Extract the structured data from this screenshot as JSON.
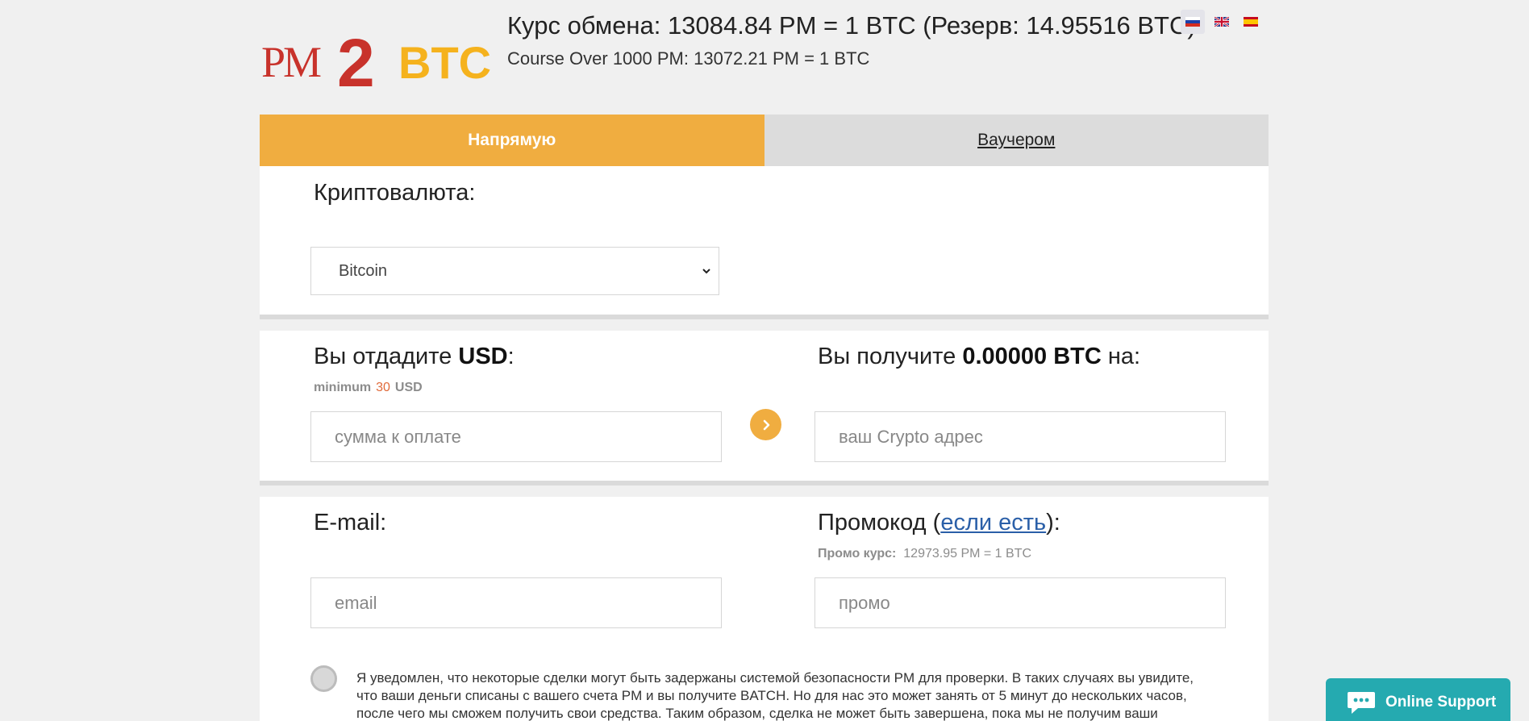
{
  "header": {
    "logo_text_pm": "PM",
    "logo_text_2": "2",
    "logo_text_btc": "BTC",
    "rate_main": "Курс обмена: 13084.84 PM = 1 BTC (Резерв: 14.95516 BTC)",
    "rate_sub": "Course Over 1000 PM: 13072.21 PM = 1 BTC",
    "languages": [
      "ru-flag-icon",
      "uk-flag-icon",
      "es-flag-icon"
    ]
  },
  "tabs": {
    "direct": "Напрямую",
    "voucher": "Ваучером"
  },
  "crypto": {
    "label": "Криптовалюта:",
    "selected": "Bitcoin"
  },
  "give": {
    "label_prefix": "Вы отдадите ",
    "currency": "USD",
    "label_suffix": ":",
    "min_label": "minimum",
    "min_value": "30",
    "min_currency": "USD",
    "placeholder": "сумма к оплате"
  },
  "receive": {
    "label_prefix": "Вы получите ",
    "amount": "0.00000 BTC",
    "label_suffix": " на:",
    "placeholder": "ваш Crypto адрес"
  },
  "email": {
    "label": "E-mail:",
    "placeholder": "email"
  },
  "promo": {
    "label_prefix": "Промокод (",
    "link": "если есть",
    "label_suffix": "):",
    "rate_label": "Промо курс:",
    "rate_value": "12973.95 PM = 1 BTC",
    "placeholder": "промо"
  },
  "notice": {
    "text": "Я уведомлен, что некоторые сделки могут быть задержаны системой безопасности PM для проверки. В таких случаях вы увидите, что ваши деньги списаны с вашего счета PM и вы получите BATCH. Но для нас это может занять от 5 минут до нескольких часов, после чего мы сможем получить свои средства. Таким образом, сделка не может быть завершена, пока мы не получим ваши"
  },
  "support": {
    "label": "Online Support"
  },
  "colors": {
    "accent": "#f0ad40",
    "support": "#25aab0",
    "logo_red": "#c8322b"
  }
}
